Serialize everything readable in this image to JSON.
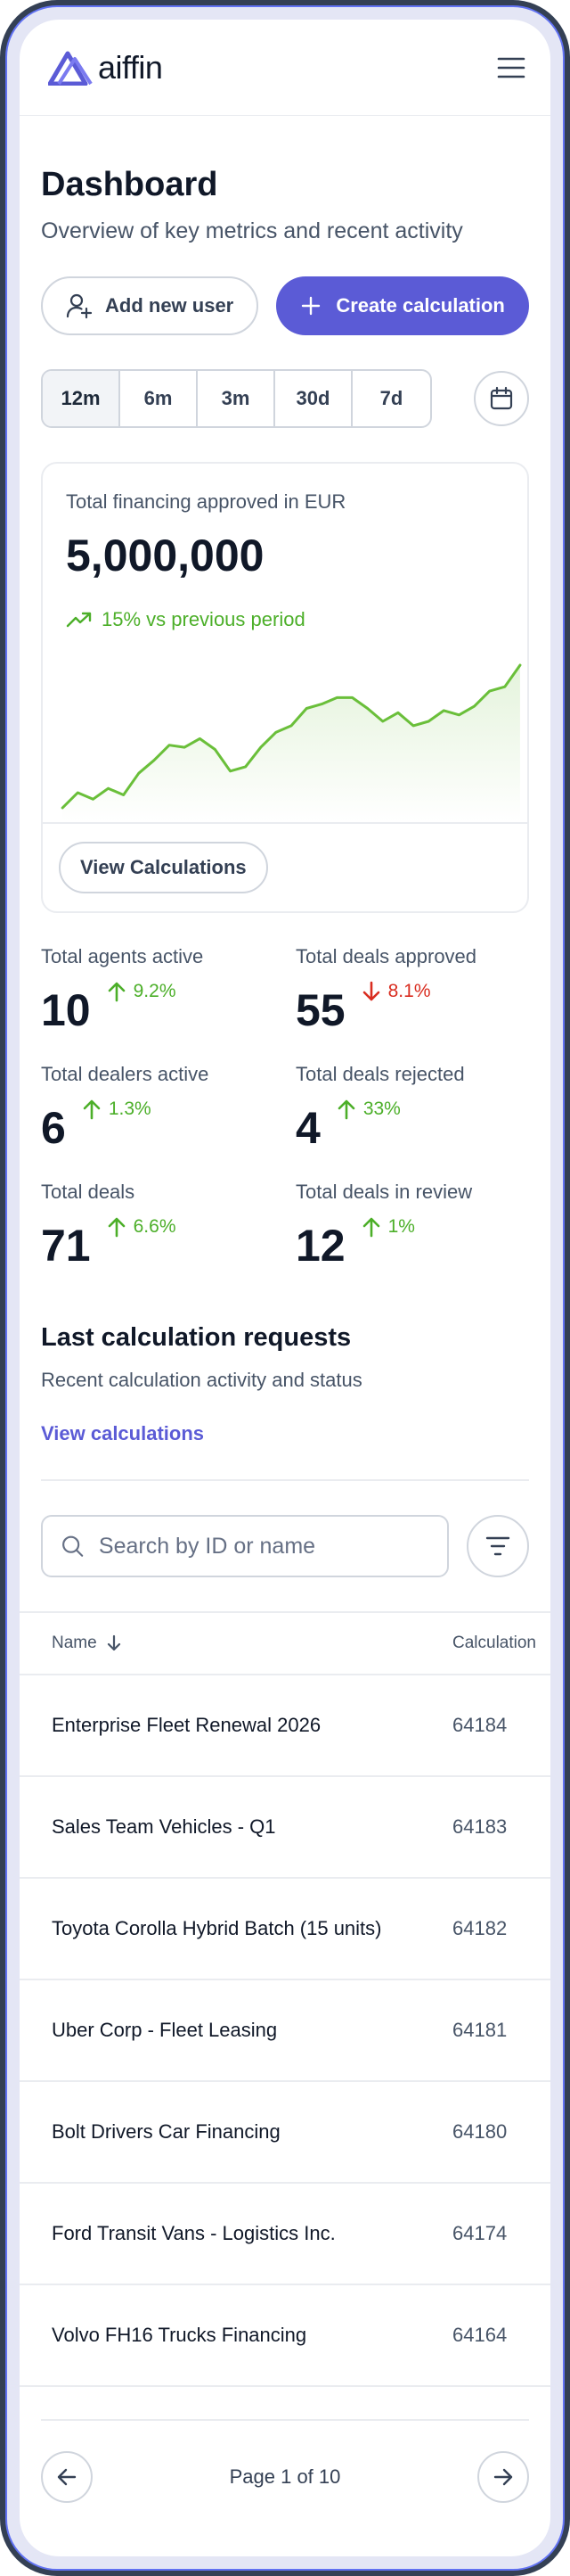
{
  "app": {
    "name": "aiffin"
  },
  "header": {
    "logo_icon": "aiffin-logo-icon",
    "menu_icon": "hamburger-menu-icon"
  },
  "page": {
    "title": "Dashboard",
    "subtitle": "Overview of key metrics and recent activity"
  },
  "actions": {
    "add_user_label": "Add new user",
    "add_user_icon": "user-plus-icon",
    "create_label": "Create calculation",
    "create_icon": "plus-icon"
  },
  "ranges": {
    "items": [
      "12m",
      "6m",
      "3m",
      "30d",
      "7d"
    ],
    "selected": "12m",
    "calendar_icon": "calendar-icon"
  },
  "financing_card": {
    "label": "Total financing approved in EUR",
    "value": "5,000,000",
    "trend_text": "15% vs previous period",
    "trend_icon": "trend-up-icon",
    "button_label": "View Calculations",
    "sparkline": [
      4,
      11,
      8,
      13,
      10,
      20,
      26,
      33,
      32,
      36,
      31,
      21,
      23,
      32,
      39,
      42,
      50,
      52,
      55,
      55,
      50,
      44,
      48,
      42,
      44,
      49,
      47,
      51,
      58,
      60,
      70
    ],
    "line_color": "#6abf3a"
  },
  "metrics": [
    {
      "label": "Total agents active",
      "value": "10",
      "change": "9.2%",
      "direction": "up"
    },
    {
      "label": "Total deals approved",
      "value": "55",
      "change": "8.1%",
      "direction": "down"
    },
    {
      "label": "Total dealers active",
      "value": "6",
      "change": "1.3%",
      "direction": "up"
    },
    {
      "label": "Total deals rejected",
      "value": "4",
      "change": "33%",
      "direction": "up"
    },
    {
      "label": "Total deals",
      "value": "71",
      "change": "6.6%",
      "direction": "up"
    },
    {
      "label": "Total deals in review",
      "value": "12",
      "change": "1%",
      "direction": "up"
    }
  ],
  "requests": {
    "title": "Last calculation requests",
    "subtitle": "Recent calculation activity and status",
    "link_label": "View calculations",
    "search_placeholder": "Search by ID or name",
    "columns": {
      "name": "Name",
      "calculation": "Calculation"
    },
    "rows": [
      {
        "name": "Enterprise Fleet Renewal 2026",
        "id": "64184"
      },
      {
        "name": "Sales Team Vehicles - Q1",
        "id": "64183"
      },
      {
        "name": "Toyota Corolla Hybrid Batch (15 units)",
        "id": "64182"
      },
      {
        "name": "Uber Corp - Fleet Leasing",
        "id": "64181"
      },
      {
        "name": "Bolt Drivers Car Financing",
        "id": "64180"
      },
      {
        "name": "Ford Transit Vans - Logistics Inc.",
        "id": "64174"
      },
      {
        "name": "Volvo FH16 Trucks Financing",
        "id": "64164"
      }
    ]
  },
  "pagination": {
    "text": "Page 1 of 10"
  },
  "colors": {
    "primary": "#5b5bd6",
    "up": "#4caf29",
    "down": "#d92d20"
  }
}
